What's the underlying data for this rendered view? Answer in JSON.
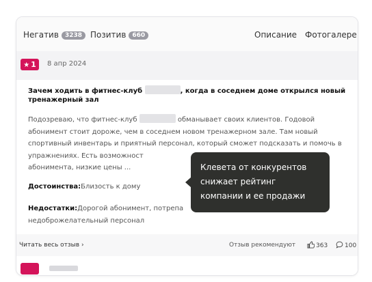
{
  "tabs": {
    "negative_label": "Негатив",
    "negative_count": "3238",
    "positive_label": "Позитив",
    "positive_count": "660",
    "description_label": "Описание",
    "photo_label": "Фотогалере"
  },
  "review": {
    "rating": "1",
    "date": "8 апр 2024",
    "title_part1": "Зачем ходить в фитнес-клуб",
    "title_part2": ", когда в соседнем доме открылся новый тренажерный зал",
    "body_part1": "Подозреваю, что фитнес-клуб",
    "body_part2": "обманывает своих клиентов. Годовой абонимент стоит дороже, чем в соседнем новом тренажерном зале. Там новый спортивный инвентарь и приятный персонал, который сможет подсказать и помочь в упражнениях. Есть возможност",
    "body_part3": "абонимента, низкие цены ...",
    "pros_label": "Достоинства:",
    "pros_text": "Близость к дому",
    "cons_label": "Недостатки:",
    "cons_text": "Дорогой абонимент, потрепа",
    "cons_text2": "недоброжелательный персонал"
  },
  "footer": {
    "read_more": "Читать весь отзыв",
    "read_more_arrow": "›",
    "recommend": "Отзыв рекомендуют",
    "likes": "363",
    "comments": "100"
  },
  "tooltip": {
    "line1": "Клевета от конкурентов",
    "line2": "снижает рейтинг",
    "line3": "компании и ее продажи"
  },
  "colors": {
    "accent": "#d4145a",
    "tooltip_bg": "#2f302d",
    "badge_gray": "#9a9aa2"
  },
  "icons": {
    "rating": "star-icon",
    "likes": "thumbs-up-icon",
    "comments": "comment-bubble-icon"
  }
}
